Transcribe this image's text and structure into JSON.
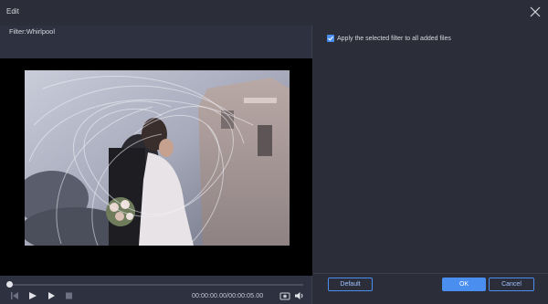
{
  "window": {
    "title": "Edit",
    "close_icon": "close-icon"
  },
  "filter": {
    "label": "Filter:Whirlpool"
  },
  "player": {
    "progress": 0.0,
    "timecode": "00:00:00.00/00:00:05.00",
    "icons": [
      "skip-back-icon",
      "play-icon",
      "play-alt-icon",
      "stop-icon",
      "snapshot-icon",
      "volume-icon"
    ]
  },
  "options": {
    "apply_all_label": "Apply the selected filter to all added files",
    "apply_all_checked": true
  },
  "buttons": {
    "default_label": "Default",
    "ok_label": "OK",
    "cancel_label": "Cancel"
  },
  "colors": {
    "accent": "#4a8ef0",
    "background": "#2b2d38",
    "preview_bg": "#000000"
  }
}
